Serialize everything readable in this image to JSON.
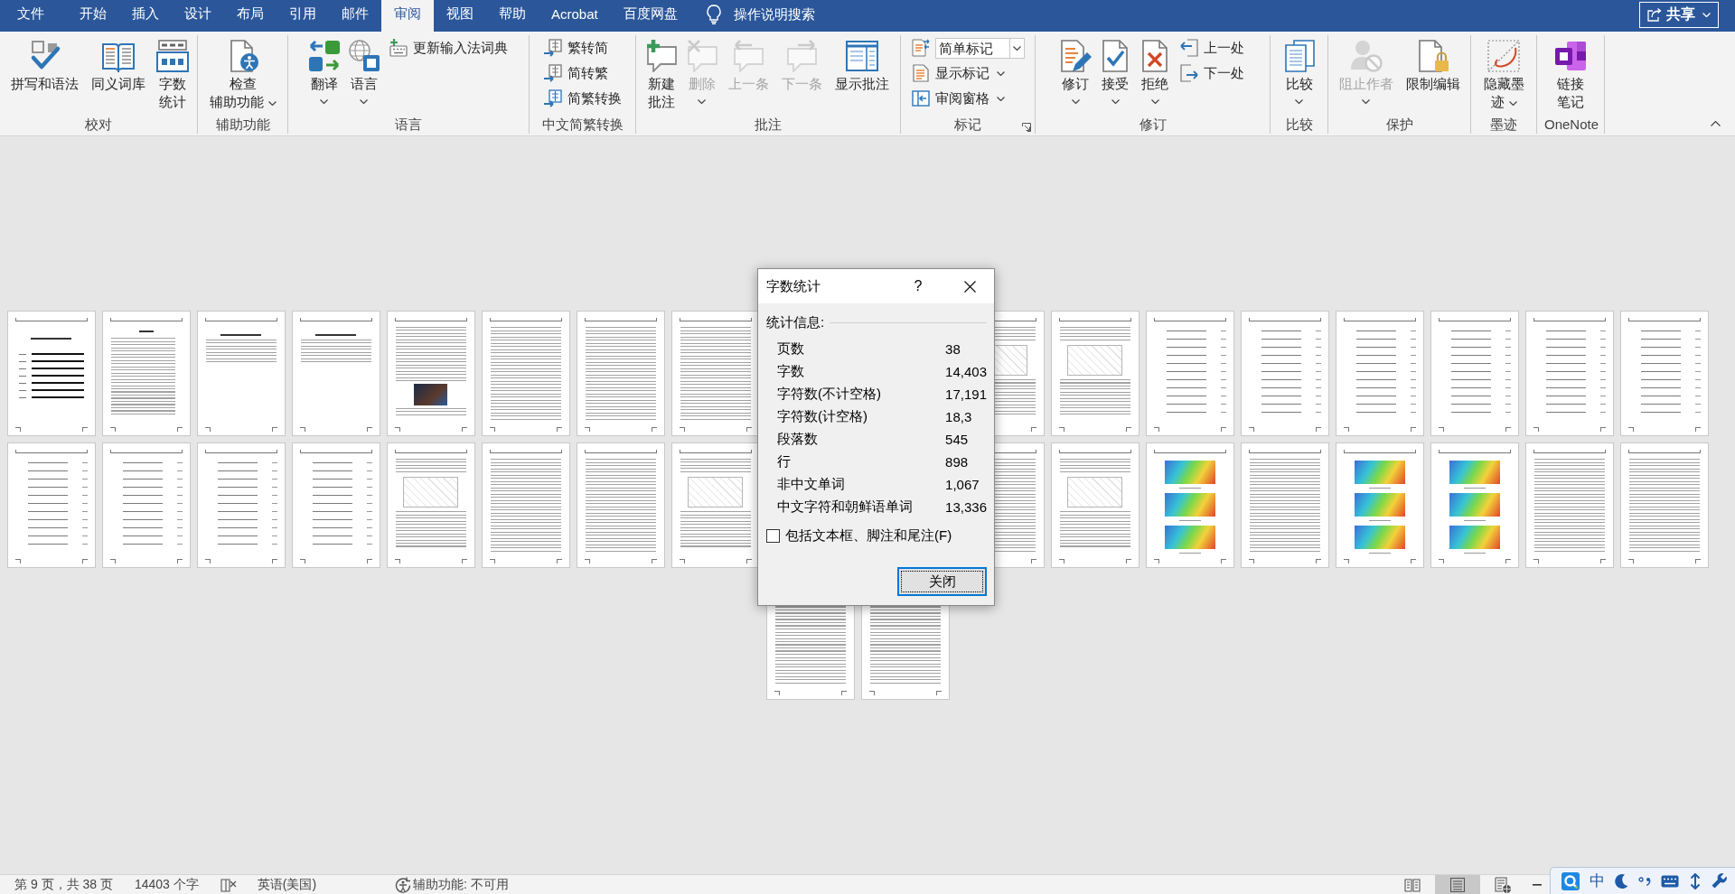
{
  "tabs": [
    {
      "label": "文件",
      "selected": false
    },
    {
      "label": "开始",
      "selected": false
    },
    {
      "label": "插入",
      "selected": false
    },
    {
      "label": "设计",
      "selected": false
    },
    {
      "label": "布局",
      "selected": false
    },
    {
      "label": "引用",
      "selected": false
    },
    {
      "label": "邮件",
      "selected": false
    },
    {
      "label": "审阅",
      "selected": true
    },
    {
      "label": "视图",
      "selected": false
    },
    {
      "label": "帮助",
      "selected": false
    },
    {
      "label": "Acrobat",
      "selected": false
    },
    {
      "label": "百度网盘",
      "selected": false
    }
  ],
  "tell_me": {
    "placeholder": "操作说明搜索"
  },
  "share_button": {
    "label": "共享"
  },
  "ribbon": {
    "groups": [
      {
        "label": "校对",
        "dialog_launcher": false,
        "buttons": [
          {
            "kind": "large",
            "label": "拼写和语法",
            "dropdown": false,
            "disabled": false
          },
          {
            "kind": "large",
            "label": "同义词库",
            "dropdown": false,
            "disabled": false
          },
          {
            "kind": "large",
            "label": "字数统计",
            "dropdown": false,
            "disabled": false
          }
        ]
      },
      {
        "label": "辅助功能",
        "dialog_launcher": false,
        "buttons": [
          {
            "kind": "large",
            "label": "检查辅助功能",
            "dropdown": true,
            "disabled": false
          }
        ]
      },
      {
        "label": "语言",
        "dialog_launcher": false,
        "buttons": [
          {
            "kind": "large",
            "label": "翻译",
            "dropdown": true,
            "disabled": false
          },
          {
            "kind": "large",
            "label": "语言",
            "dropdown": true,
            "disabled": false
          },
          {
            "kind": "small",
            "label": "更新输入法词典",
            "dropdown": false,
            "disabled": false
          }
        ]
      },
      {
        "label": "中文简繁转换",
        "dialog_launcher": false,
        "buttons": [
          {
            "kind": "small",
            "label": "繁转简",
            "dropdown": false,
            "disabled": false
          },
          {
            "kind": "small",
            "label": "简转繁",
            "dropdown": false,
            "disabled": false
          },
          {
            "kind": "small",
            "label": "简繁转换",
            "dropdown": false,
            "disabled": false
          }
        ]
      },
      {
        "label": "批注",
        "dialog_launcher": false,
        "buttons": [
          {
            "kind": "large",
            "label": "新建批注",
            "dropdown": false,
            "disabled": false
          },
          {
            "kind": "large",
            "label": "删除",
            "dropdown": true,
            "disabled": true
          },
          {
            "kind": "large",
            "label": "上一条",
            "dropdown": false,
            "disabled": true
          },
          {
            "kind": "large",
            "label": "下一条",
            "dropdown": false,
            "disabled": true
          },
          {
            "kind": "large",
            "label": "显示批注",
            "dropdown": false,
            "disabled": false
          }
        ]
      },
      {
        "label": "标记",
        "dialog_launcher": true,
        "buttons": [
          {
            "kind": "combo",
            "value": "简单标记",
            "disabled": false
          },
          {
            "kind": "small",
            "label": "显示标记",
            "dropdown": true,
            "disabled": false
          },
          {
            "kind": "small",
            "label": "审阅窗格",
            "dropdown": true,
            "disabled": false
          }
        ]
      },
      {
        "label": "修订",
        "dialog_launcher": false,
        "buttons": [
          {
            "kind": "large",
            "label": "修订",
            "dropdown": true,
            "disabled": false
          },
          {
            "kind": "large",
            "label": "接受",
            "dropdown": true,
            "disabled": false
          },
          {
            "kind": "large",
            "label": "拒绝",
            "dropdown": true,
            "disabled": false
          },
          {
            "kind": "small",
            "label": "上一处",
            "dropdown": false,
            "disabled": false
          },
          {
            "kind": "small",
            "label": "下一处",
            "dropdown": false,
            "disabled": false
          }
        ]
      },
      {
        "label": "比较",
        "dialog_launcher": false,
        "buttons": [
          {
            "kind": "large",
            "label": "比较",
            "dropdown": true,
            "disabled": false
          }
        ]
      },
      {
        "label": "保护",
        "dialog_launcher": false,
        "buttons": [
          {
            "kind": "large",
            "label": "阻止作者",
            "dropdown": true,
            "disabled": true
          },
          {
            "kind": "large",
            "label": "限制编辑",
            "dropdown": false,
            "disabled": false
          }
        ]
      },
      {
        "label": "墨迹",
        "dialog_launcher": false,
        "buttons": [
          {
            "kind": "large",
            "label": "隐藏墨迹",
            "dropdown": true,
            "disabled": false
          }
        ]
      },
      {
        "label": "OneNote",
        "dialog_launcher": false,
        "buttons": [
          {
            "kind": "large",
            "label": "链接笔记",
            "dropdown": false,
            "disabled": false
          }
        ]
      }
    ]
  },
  "pages": [
    {
      "kind": "cover"
    },
    {
      "kind": "contents"
    },
    {
      "kind": "abstract"
    },
    {
      "kind": "abstract"
    },
    {
      "kind": "photo"
    },
    {
      "kind": "text"
    },
    {
      "kind": "text"
    },
    {
      "kind": "text"
    },
    {
      "kind": "covered"
    },
    {
      "kind": "covered"
    },
    {
      "kind": "figure"
    },
    {
      "kind": "figure"
    },
    {
      "kind": "equations"
    },
    {
      "kind": "equations"
    },
    {
      "kind": "equations"
    },
    {
      "kind": "equations"
    },
    {
      "kind": "equations"
    },
    {
      "kind": "equations"
    },
    {
      "kind": "equations"
    },
    {
      "kind": "equations"
    },
    {
      "kind": "equations"
    },
    {
      "kind": "equations"
    },
    {
      "kind": "figure"
    },
    {
      "kind": "text"
    },
    {
      "kind": "text"
    },
    {
      "kind": "figure"
    },
    {
      "kind": "covered"
    },
    {
      "kind": "covered"
    },
    {
      "kind": "text"
    },
    {
      "kind": "figure"
    },
    {
      "kind": "color-figure"
    },
    {
      "kind": "text"
    },
    {
      "kind": "color-figure"
    },
    {
      "kind": "color-figure"
    },
    {
      "kind": "text"
    },
    {
      "kind": "text"
    },
    {
      "kind": "text"
    },
    {
      "kind": "text"
    }
  ],
  "dialog": {
    "title": "字数统计",
    "help": "?",
    "section": "统计信息:",
    "stats": [
      {
        "label": "页数",
        "value": "38"
      },
      {
        "label": "字数",
        "value": "14,403"
      },
      {
        "label": "字符数(不计空格)",
        "value": "17,191"
      },
      {
        "label": "字符数(计空格)",
        "value": "18,3"
      },
      {
        "label": "段落数",
        "value": "545"
      },
      {
        "label": "行",
        "value": "898"
      },
      {
        "label": "非中文单词",
        "value": "1,067"
      },
      {
        "label": "中文字符和朝鲜语单词",
        "value": "13,336"
      }
    ],
    "checkbox": {
      "label": "包括文本框、脚注和尾注(F)",
      "checked": false
    },
    "button": "关闭"
  },
  "status_bar": {
    "page": "第 9 页，共 38 页",
    "words": "14403 个字",
    "language": "英语(美国)",
    "accessibility": "辅助功能: 不可用",
    "views": [
      {
        "selected": false
      },
      {
        "selected": true
      },
      {
        "selected": false
      }
    ]
  },
  "ime_toolbar": {
    "mode": "中"
  }
}
